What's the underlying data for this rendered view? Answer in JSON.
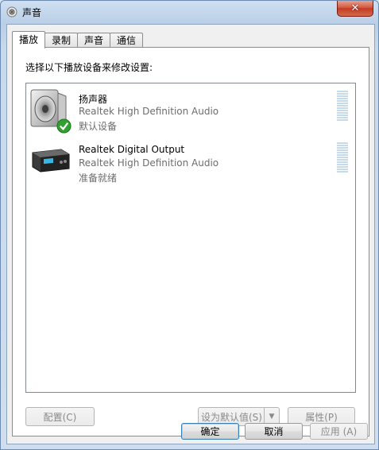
{
  "window": {
    "title": "声音",
    "close_glyph": "✕"
  },
  "tabs": [
    {
      "label": "播放",
      "active": true
    },
    {
      "label": "录制",
      "active": false
    },
    {
      "label": "声音",
      "active": false
    },
    {
      "label": "通信",
      "active": false
    }
  ],
  "playback": {
    "instruction": "选择以下播放设备来修改设置:",
    "devices": [
      {
        "name": "扬声器",
        "driver": "Realtek High Definition Audio",
        "status": "默认设备",
        "icon": "speaker-icon",
        "is_default": true
      },
      {
        "name": "Realtek Digital Output",
        "driver": "Realtek High Definition Audio",
        "status": "准备就绪",
        "icon": "digital-output-icon",
        "is_default": false
      }
    ],
    "buttons": {
      "configure": "配置(C)",
      "set_default": "设为默认值(S)",
      "properties": "属性(P)"
    }
  },
  "footer": {
    "ok": "确定",
    "cancel": "取消",
    "apply": "应用 (A)"
  }
}
